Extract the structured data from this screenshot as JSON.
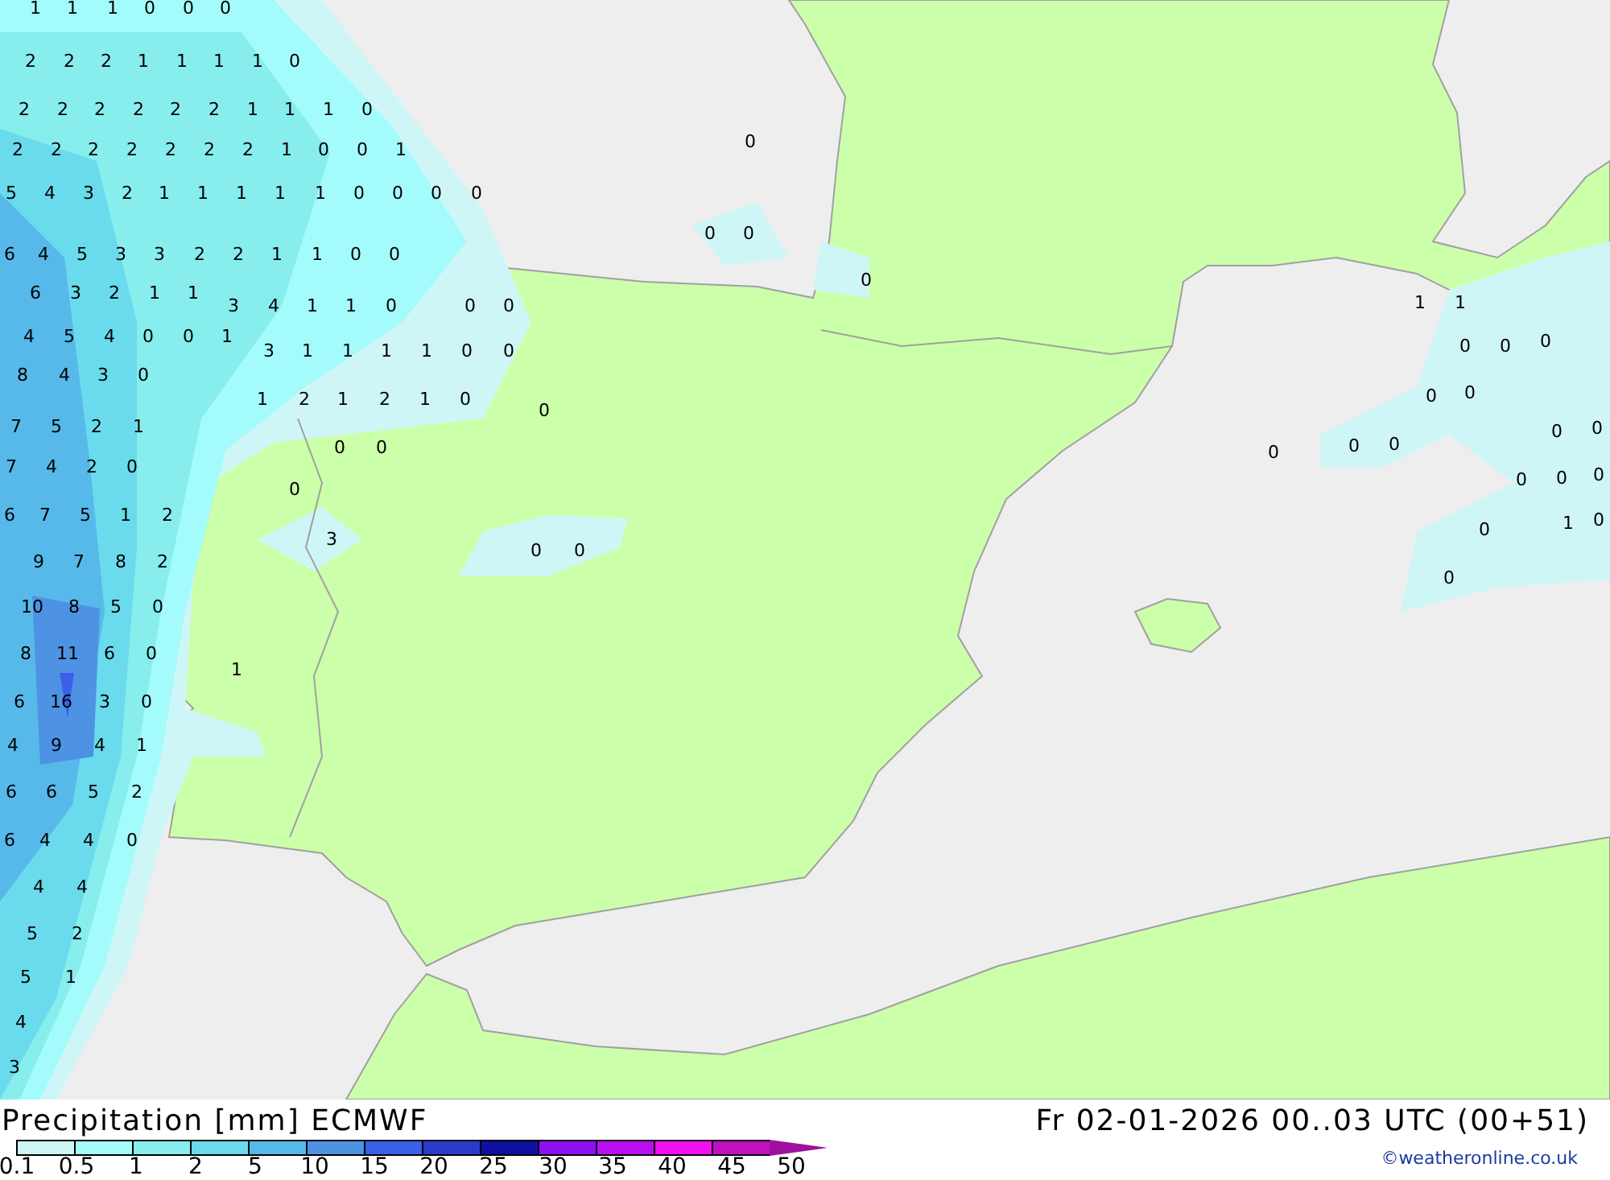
{
  "map": {
    "labels": [
      "1",
      "1",
      "1",
      "0",
      "0",
      "0",
      "2",
      "2",
      "2",
      "1",
      "1",
      "1",
      "1",
      "0",
      "2",
      "2",
      "2",
      "2",
      "2",
      "2",
      "1",
      "1",
      "1",
      "0",
      "2",
      "2",
      "2",
      "2",
      "2",
      "2",
      "2",
      "1",
      "0",
      "0",
      "1",
      "5",
      "4",
      "3",
      "2",
      "1",
      "1",
      "1",
      "1",
      "1",
      "0",
      "0",
      "0",
      "0",
      "6",
      "4",
      "5",
      "3",
      "3",
      "2",
      "2",
      "1",
      "1",
      "0",
      "0",
      "6",
      "3",
      "2",
      "1",
      "1",
      "3",
      "4",
      "1",
      "1",
      "0",
      "0",
      "0",
      "4",
      "5",
      "4",
      "0",
      "0",
      "1",
      "3",
      "1",
      "1",
      "1",
      "1",
      "0",
      "0",
      "8",
      "4",
      "3",
      "0",
      "1",
      "2",
      "1",
      "2",
      "1",
      "0",
      "0",
      "7",
      "5",
      "2",
      "1",
      "0",
      "0",
      "7",
      "4",
      "2",
      "0",
      "0",
      "6",
      "7",
      "5",
      "1",
      "2",
      "3",
      "0",
      "0",
      "9",
      "7",
      "8",
      "2",
      "10",
      "8",
      "5",
      "0",
      "8",
      "11",
      "6",
      "0",
      "1",
      "6",
      "16",
      "3",
      "0",
      "4",
      "9",
      "4",
      "1",
      "6",
      "6",
      "5",
      "2",
      "6",
      "4",
      "4",
      "0",
      "4",
      "4",
      "5",
      "2",
      "5",
      "1",
      "4",
      "3",
      "0",
      "0",
      "0",
      "0",
      "1",
      "1",
      "0",
      "0",
      "0",
      "0",
      "0",
      "0",
      "0",
      "0",
      "0",
      "0",
      "0",
      "0",
      "0",
      "0",
      "1",
      "0",
      "0"
    ]
  },
  "footer": {
    "title": "Precipitation [mm] ECMWF",
    "valid_time": "Fr 02-01-2026 00..03 UTC (00+51)",
    "credit": "©weatheronline.co.uk",
    "legend": {
      "bins": [
        {
          "color": "#cff6f6"
        },
        {
          "color": "#a4fbfb"
        },
        {
          "color": "#87eded"
        },
        {
          "color": "#6adbec"
        },
        {
          "color": "#57b9ea"
        },
        {
          "color": "#4e93e3"
        },
        {
          "color": "#3b5fe9"
        },
        {
          "color": "#2a3cc9"
        },
        {
          "color": "#1010a0"
        },
        {
          "color": "#8c10f0"
        },
        {
          "color": "#b810f0"
        },
        {
          "color": "#f010f0"
        },
        {
          "color": "#c010c0"
        }
      ],
      "ticks": [
        "0.1",
        "0.5",
        "1",
        "2",
        "5",
        "10",
        "15",
        "20",
        "25",
        "30",
        "35",
        "40",
        "45",
        "50"
      ]
    }
  }
}
